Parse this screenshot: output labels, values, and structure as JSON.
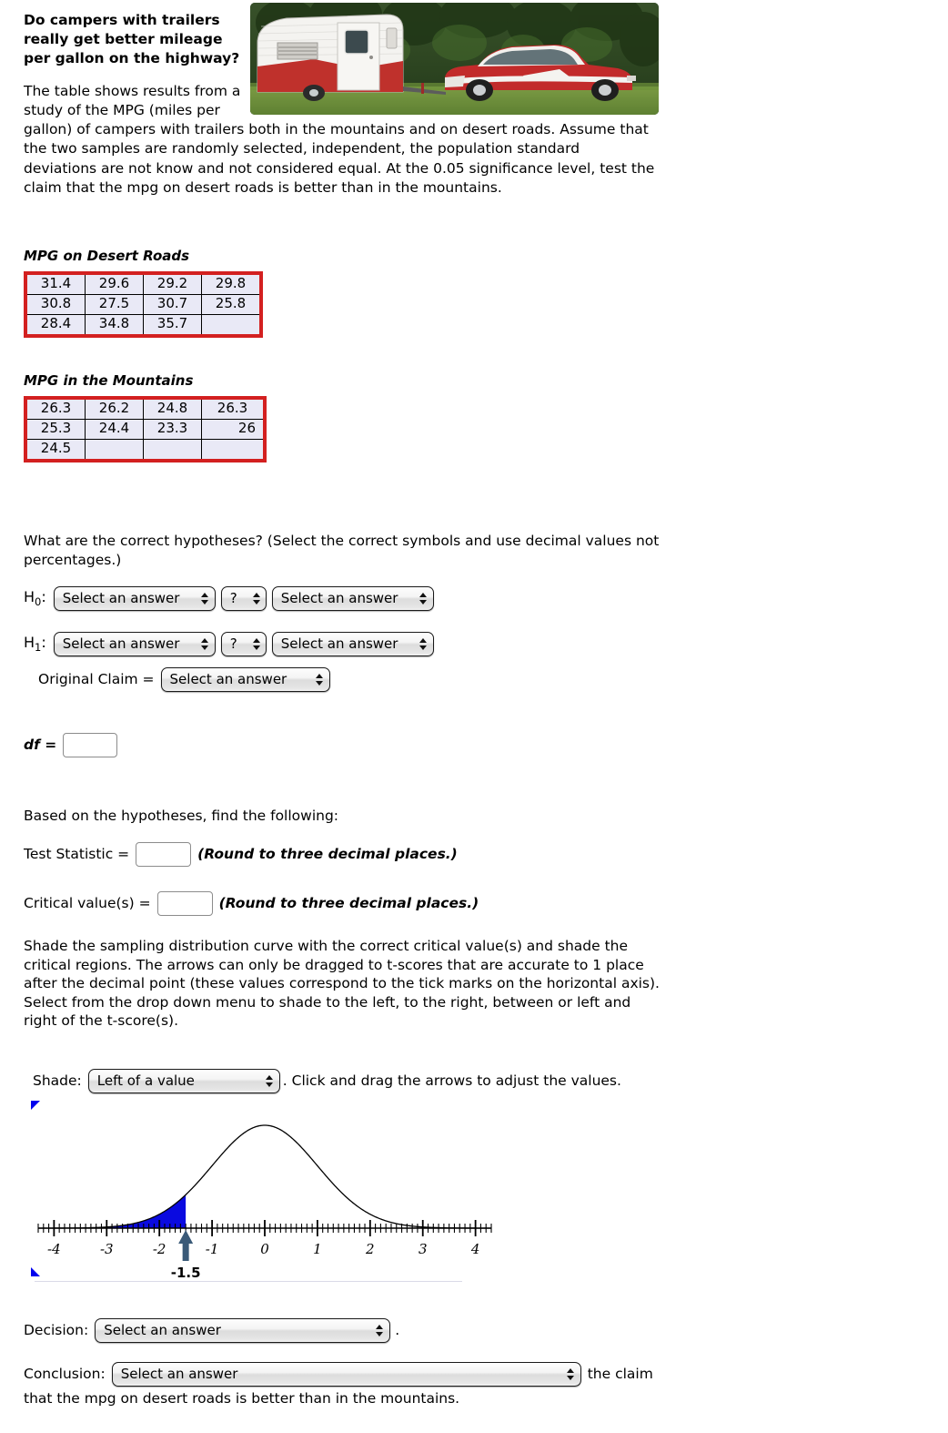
{
  "intro": {
    "heading": "Do campers with trailers really get better mileage per gallon on the highway?",
    "paragraph_part1": "The table shows results from a study of the MPG (miles per",
    "paragraph_part2": "gallon) of campers with trailers both in the mountains and on desert roads. Assume that the two samples are randomly selected, independent, the population standard deviations are not know and not considered equal. At the 0.05 significance level, test the claim that the mpg on desert roads is better than in the mountains."
  },
  "photo": {
    "alt": "vintage red and white camper trailer towed by a classic red and white car on grass",
    "colors": {
      "sky_trees": "#2f4a24",
      "grass": "#6e8f3c",
      "trailer_red": "#c0302c",
      "trailer_white": "#f2f2f0",
      "car_red": "#c22b2b"
    }
  },
  "tables": {
    "desert": {
      "caption": "MPG on Desert Roads",
      "rows": [
        [
          "31.4",
          "29.6",
          "29.2",
          "29.8"
        ],
        [
          "30.8",
          "27.5",
          "30.7",
          "25.8"
        ],
        [
          "28.4",
          "34.8",
          "35.7",
          ""
        ]
      ]
    },
    "mountains": {
      "caption": "MPG in the Mountains",
      "rows": [
        [
          "26.3",
          "26.2",
          "24.8",
          "26.3"
        ],
        [
          "25.3",
          "24.4",
          "23.3",
          "26"
        ],
        [
          "24.5",
          "",
          "",
          ""
        ]
      ]
    },
    "border_color": "#d32020",
    "cell_fill": "#e9e9f6"
  },
  "hypotheses": {
    "prompt": "What are the correct hypotheses? (Select the correct symbols and use decimal values not percentages.)",
    "h0_label": "H",
    "h0_sub": "0",
    "h1_label": "H",
    "h1_sub": "1",
    "colon": ":",
    "select_placeholder": "Select an answer",
    "question_symbol": "?",
    "original_claim_label": "Original Claim =",
    "original_claim_value": "Select an answer"
  },
  "df": {
    "label": "df =",
    "value": ""
  },
  "findings": {
    "prompt": "Based on the hypotheses, find the following:",
    "test_statistic_label": "Test Statistic =",
    "test_statistic_value": "",
    "test_statistic_note": "(Round to three decimal places.)",
    "critical_value_label": "Critical value(s) =",
    "critical_value_value": "",
    "critical_value_note": "(Round to three decimal places.)"
  },
  "shade_instructions": {
    "line1": "Shade the sampling distribution curve with the correct critical value(s) and shade the",
    "line2": "critical regions. The arrows can only be dragged to t-scores that are accurate to 1",
    "line3": "place after the decimal point (these values correspond to the tick marks on the",
    "line4": "horizontal axis). Select from the drop down menu to shade to the left, to the right,",
    "line5": "between or left and right of the t-score(s)."
  },
  "shade_control": {
    "label": "Shade:",
    "selected": "Left of a value",
    "trailing_text": ". Click and drag the arrows to adjust the values."
  },
  "chart_data": {
    "type": "area",
    "title": "",
    "xlabel": "",
    "ylabel": "",
    "distribution": "standard normal / t sampling distribution",
    "xlim": [
      -4.3,
      4.3
    ],
    "x_tick_labels": [
      "-4",
      "-3",
      "-2",
      "-1",
      "0",
      "1",
      "2",
      "3",
      "4"
    ],
    "x_tick_values": [
      -4,
      -3,
      -2,
      -1,
      0,
      1,
      2,
      3,
      4
    ],
    "minor_tick_step": 0.1,
    "grid": false,
    "legend": "none",
    "shaded_region": {
      "mode": "Left of a value",
      "from": -4.3,
      "to": -1.5,
      "color": "#0a0ae0"
    },
    "markers": [
      {
        "name": "critical-value-arrow",
        "value": -1.5,
        "label": "-1.5",
        "color": "#3a5a78",
        "direction": "up"
      }
    ],
    "curve_color": "#000000"
  },
  "decision": {
    "label": "Decision:",
    "value": "Select an answer",
    "trailing": "."
  },
  "conclusion": {
    "label": "Conclusion:",
    "value": "Select an answer",
    "trailing_inline": "the claim",
    "trailing_line": "that the mpg on desert roads is better than in the mountains."
  }
}
